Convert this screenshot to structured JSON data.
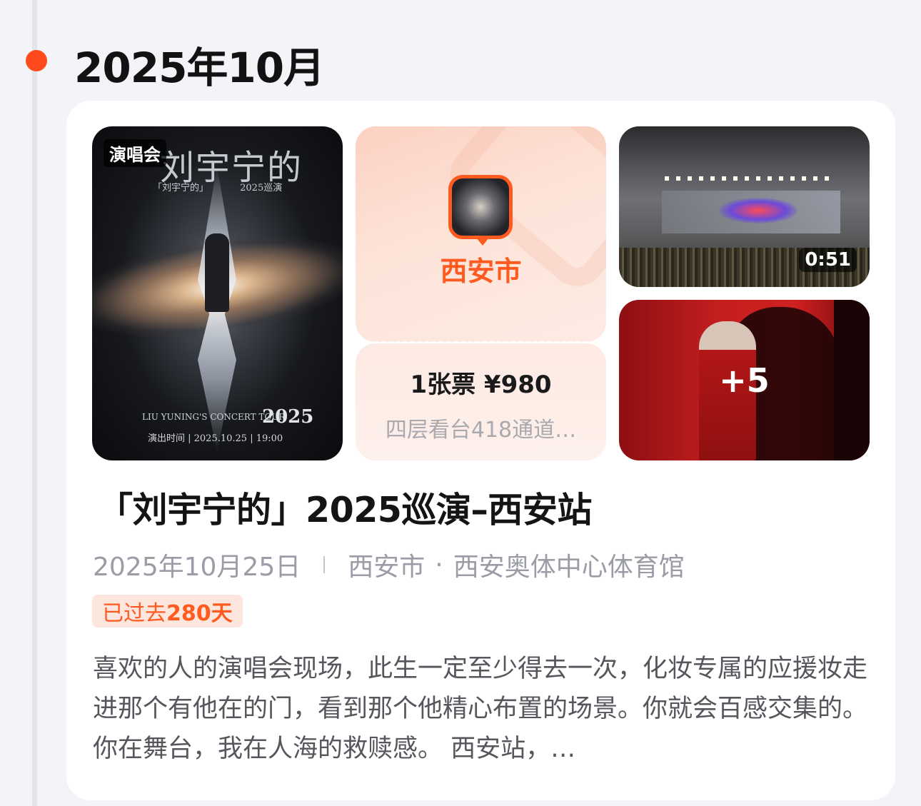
{
  "timeline": {
    "month_title": "2025年10月",
    "dot_color": "#ff4a1c"
  },
  "event": {
    "category_tag": "演唱会",
    "poster": {
      "title_text": "刘宇宁的",
      "subtitle_text": "「刘宇宁的」 2025巡演",
      "tour_text": "LIU YUNING'S CONCERT TOUR",
      "year_text": "2025",
      "time_text": "演出时间 | 2025.10.25 | 19:00"
    },
    "ticket": {
      "city": "西安市",
      "count_price": "1张票 ¥980",
      "seat": "四层看台418通道…"
    },
    "video_duration": "0:51",
    "more_photos": "+5",
    "title": "「刘宇宁的」2025巡演–西安站",
    "date": "2025年10月25日",
    "city": "西安市",
    "venue": "西安奥体中心体育馆",
    "elapsed_prefix": "已过去",
    "elapsed_days": "280天",
    "description": "喜欢的人的演唱会现场，此生一定至少得去一次，化妆专属的应援妆走进那个有他在的门，看到那个他精心布置的场景。你就会百感交集的。你在舞台，我在人海的救赎感。 西安站，…"
  },
  "colors": {
    "accent": "#ff5a1f",
    "background": "#f3f4f8",
    "card": "#ffffff"
  }
}
